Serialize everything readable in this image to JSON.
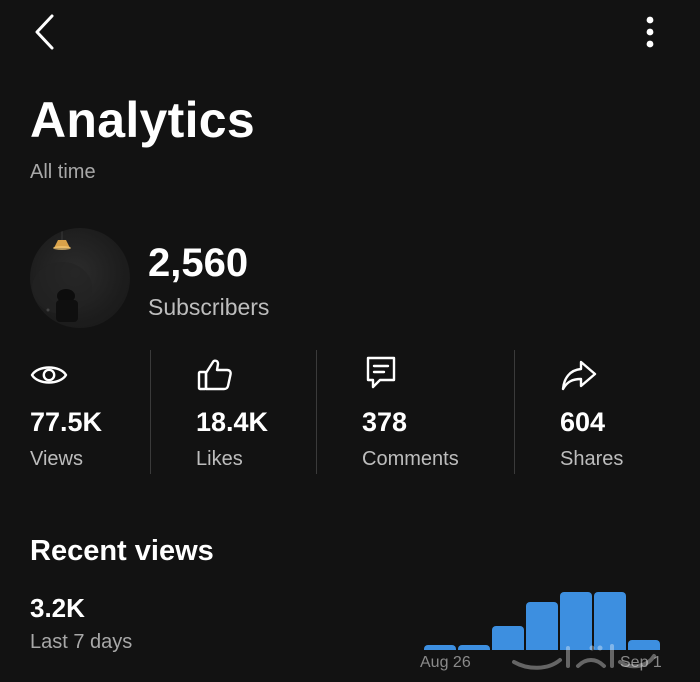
{
  "header": {
    "title": "Analytics",
    "subtitle": "All time"
  },
  "channel": {
    "subscriber_count": "2,560",
    "subscriber_label": "Subscribers"
  },
  "stats": [
    {
      "icon": "eye-icon",
      "value": "77.5K",
      "label": "Views"
    },
    {
      "icon": "thumbs-up-icon",
      "value": "18.4K",
      "label": "Likes"
    },
    {
      "icon": "comment-icon",
      "value": "378",
      "label": "Comments"
    },
    {
      "icon": "share-icon",
      "value": "604",
      "label": "Shares"
    }
  ],
  "recent": {
    "title": "Recent views",
    "value": "3.2K",
    "period": "Last 7 days"
  },
  "chart_data": {
    "type": "bar",
    "categories": [
      "Aug 26",
      "",
      "",
      "",
      "",
      "",
      "Sep 1"
    ],
    "values": [
      1,
      1,
      5,
      10,
      12,
      12,
      2
    ],
    "x_tick_labels": [
      "Aug 26",
      "Sep 1"
    ],
    "color": "#3d8fe0"
  },
  "colors": {
    "background": "#121212",
    "text_primary": "#ffffff",
    "text_secondary": "#a8a8a8",
    "accent_bar": "#3d8fe0"
  }
}
